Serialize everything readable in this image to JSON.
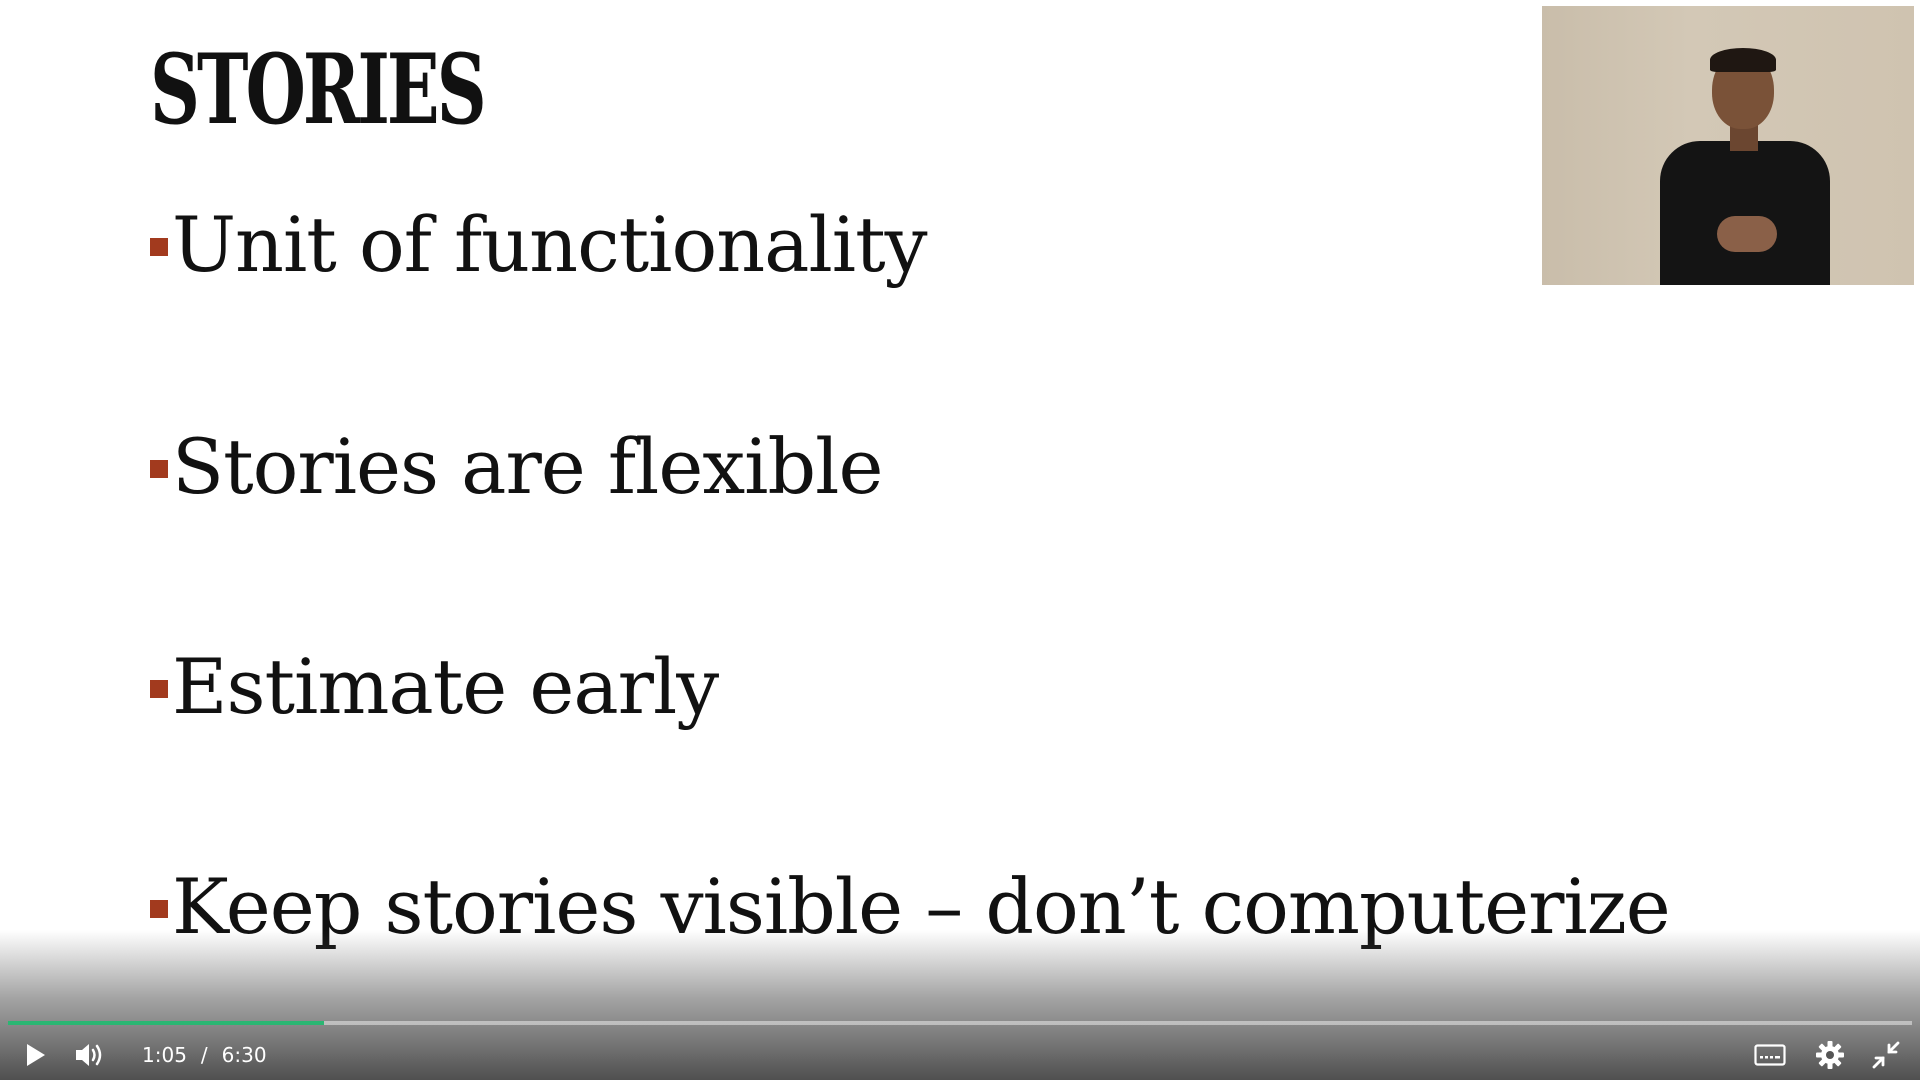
{
  "slide": {
    "title": "STORIES",
    "bullets": [
      "Unit of functionality",
      "Stories are flexible",
      "Estimate early",
      "Keep stories visible – don’t computerize"
    ],
    "accent_color": "#a23a1e"
  },
  "player": {
    "current_time": "1:05",
    "separator": "/",
    "duration": "6:30",
    "progress_fraction": 0.166,
    "progress_color": "#2bb673",
    "icons": {
      "play": "play-icon",
      "volume": "volume-icon",
      "captions": "captions-icon",
      "settings": "gear-icon",
      "exit_fullscreen": "exit-fullscreen-icon"
    }
  }
}
